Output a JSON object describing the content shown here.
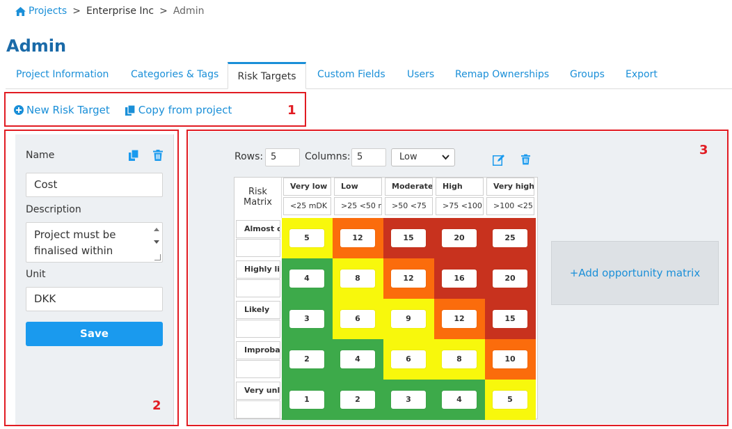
{
  "breadcrumb": {
    "projects": "Projects",
    "company": "Enterprise Inc",
    "current": "Admin",
    "separator": ">"
  },
  "page_title": "Admin",
  "tabs": [
    {
      "label": "Project Information"
    },
    {
      "label": "Categories & Tags"
    },
    {
      "label": "Risk Targets",
      "active": true
    },
    {
      "label": "Custom Fields"
    },
    {
      "label": "Users"
    },
    {
      "label": "Remap Ownerships"
    },
    {
      "label": "Groups"
    },
    {
      "label": "Export"
    }
  ],
  "toolbar": {
    "new_label": "New Risk Target",
    "copy_label": "Copy from project"
  },
  "annotations": {
    "one": "1",
    "two": "2",
    "three": "3"
  },
  "form": {
    "name_label": "Name",
    "name_value": "Cost",
    "description_label": "Description",
    "description_value": "Project must be finalised within",
    "unit_label": "Unit",
    "unit_value": "DKK",
    "save_label": "Save"
  },
  "matrix_controls": {
    "rows_label": "Rows:",
    "rows_value": "5",
    "columns_label": "Columns:",
    "columns_value": "5",
    "level_value": "Low"
  },
  "matrix": {
    "corner_line1": "Risk",
    "corner_line2": "Matrix",
    "columns": [
      {
        "name": "Very low",
        "range": "<25 mDK"
      },
      {
        "name": "Low",
        "range": ">25 <50 r"
      },
      {
        "name": "Moderate",
        "range": ">50  <75"
      },
      {
        "name": "High",
        "range": ">75 <100"
      },
      {
        "name": "Very high",
        "range": ">100  <25"
      }
    ],
    "rows": [
      {
        "name": "Almost c",
        "sub": "",
        "values": [
          "5",
          "12",
          "15",
          "20",
          "25"
        ],
        "colors": [
          "#f8f80c",
          "#fb6c0c",
          "#c8321e",
          "#c8321e",
          "#c8321e"
        ]
      },
      {
        "name": "Highly li",
        "sub": "",
        "values": [
          "4",
          "8",
          "12",
          "16",
          "20"
        ],
        "colors": [
          "#3daa4a",
          "#f8f80c",
          "#fb6c0c",
          "#c8321e",
          "#c8321e"
        ]
      },
      {
        "name": "Likely",
        "sub": "",
        "values": [
          "3",
          "6",
          "9",
          "12",
          "15"
        ],
        "colors": [
          "#3daa4a",
          "#f8f80c",
          "#f8f80c",
          "#fb6c0c",
          "#c8321e"
        ]
      },
      {
        "name": "Improba",
        "sub": "",
        "values": [
          "2",
          "4",
          "6",
          "8",
          "10"
        ],
        "colors": [
          "#3daa4a",
          "#3daa4a",
          "#f8f80c",
          "#f8f80c",
          "#fb6c0c"
        ]
      },
      {
        "name": "Very unl",
        "sub": "",
        "values": [
          "1",
          "2",
          "3",
          "4",
          "5"
        ],
        "colors": [
          "#3daa4a",
          "#3daa4a",
          "#3daa4a",
          "#3daa4a",
          "#f8f80c"
        ]
      }
    ]
  },
  "opportunity_label": "+Add opportunity matrix",
  "colors": {
    "accent": "#1a8fd8",
    "title": "#1a6aa8",
    "annotation_red": "#e11b22"
  }
}
